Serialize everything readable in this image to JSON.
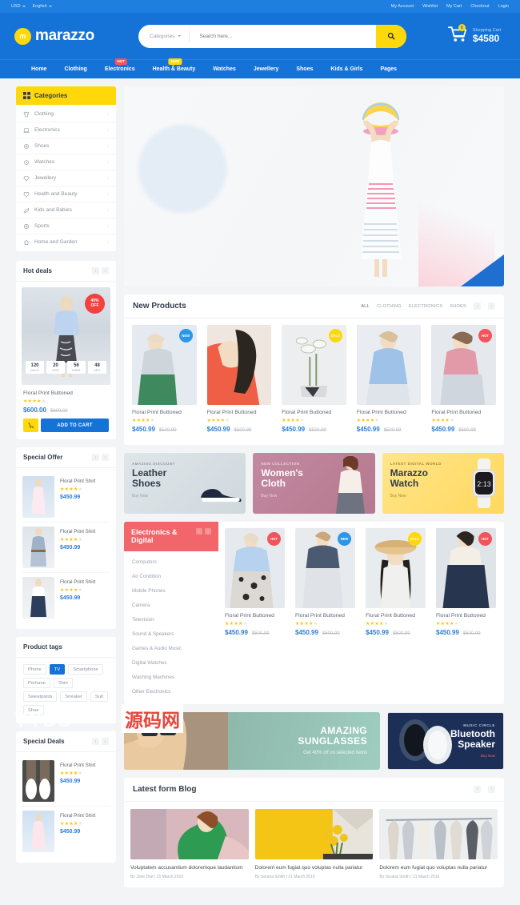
{
  "topbar": {
    "currency": "USD",
    "language": "English",
    "links": [
      "My Account",
      "Wishlist",
      "My Cart",
      "Checkout",
      "Login"
    ]
  },
  "header": {
    "logo_mark": "m",
    "logo_text": "marazzo",
    "search": {
      "category_label": "Categories",
      "placeholder": "Search here...",
      "value": "",
      "button_icon": "search-icon"
    },
    "cart": {
      "label": "Shopping Cart",
      "total": "$4580",
      "count": "0"
    }
  },
  "nav": {
    "items": [
      {
        "label": "Home",
        "badge": null
      },
      {
        "label": "Clothing",
        "badge": null
      },
      {
        "label": "Electronics",
        "badge": "HOT",
        "badge_type": "hot"
      },
      {
        "label": "Health & Beauty",
        "badge": "NEW",
        "badge_type": "new"
      },
      {
        "label": "Watches",
        "badge": null
      },
      {
        "label": "Jewellery",
        "badge": null
      },
      {
        "label": "Shoes",
        "badge": null
      },
      {
        "label": "Kids & Girls",
        "badge": null
      },
      {
        "label": "Pages",
        "badge": null
      }
    ]
  },
  "sidebar": {
    "categories": {
      "title": "Categories",
      "icon": "grid-icon",
      "items": [
        {
          "label": "Clothing",
          "icon": "shirt-icon"
        },
        {
          "label": "Electronics",
          "icon": "laptop-icon"
        },
        {
          "label": "Shoes",
          "icon": "shoe-icon"
        },
        {
          "label": "Watches",
          "icon": "watch-icon"
        },
        {
          "label": "Jewellery",
          "icon": "gem-icon"
        },
        {
          "label": "Health and Beauty",
          "icon": "heart-icon"
        },
        {
          "label": "Kids and Babies",
          "icon": "baby-icon"
        },
        {
          "label": "Sports",
          "icon": "ball-icon"
        },
        {
          "label": "Home and Garden",
          "icon": "home-icon"
        }
      ]
    },
    "hot_deals": {
      "title": "Hot deals",
      "discount_badge_line1": "40%",
      "discount_badge_line2": "OFF",
      "countdown": [
        {
          "num": "120",
          "unit": "DAYS"
        },
        {
          "num": "20",
          "unit": "HRS"
        },
        {
          "num": "56",
          "unit": "MINS"
        },
        {
          "num": "48",
          "unit": "SEC"
        }
      ],
      "product_name": "Floral Print Buttoned",
      "rating": 4,
      "price": "$600.00",
      "price_old": "$800.00",
      "add_to_cart": "ADD TO CART"
    },
    "special_offer": {
      "title": "Special Offer",
      "items": [
        {
          "name": "Floral Print Shirt",
          "rating": 4,
          "price": "$450.99"
        },
        {
          "name": "Floral Print Shirt",
          "rating": 4,
          "price": "$450.99"
        },
        {
          "name": "Floral Print Shirt",
          "rating": 4,
          "price": "$450.99"
        }
      ]
    },
    "product_tags": {
      "title": "Product tags",
      "tags": [
        {
          "label": "Phone",
          "active": false
        },
        {
          "label": "TV",
          "active": true
        },
        {
          "label": "Smartphone",
          "active": false
        },
        {
          "label": "Perfume",
          "active": false
        },
        {
          "label": "Shirt",
          "active": false
        },
        {
          "label": "Sweatpants",
          "active": false
        },
        {
          "label": "Sneaker",
          "active": false
        },
        {
          "label": "Suit",
          "active": false
        },
        {
          "label": "Shoe",
          "active": false
        }
      ]
    },
    "special_deals": {
      "title": "Special Deals",
      "items": [
        {
          "name": "Floral Print Shirt",
          "rating": 4,
          "price": "$450.99"
        },
        {
          "name": "Floral Print Shirt",
          "rating": 4,
          "price": "$450.99"
        }
      ]
    }
  },
  "main": {
    "new_products": {
      "title": "New Products",
      "tabs": [
        "ALL",
        "CLOTHING",
        "ELECTRONICS",
        "SHOES"
      ],
      "active_tab": "ALL",
      "items": [
        {
          "name": "Floral Print Buttoned",
          "rating": 4,
          "price": "$450.99",
          "price_old": "$500.99",
          "badge": "NEW",
          "badge_type": "new"
        },
        {
          "name": "Floral Print Buttoned",
          "rating": 4,
          "price": "$450.99",
          "price_old": "$500.99",
          "badge": null,
          "badge_type": null
        },
        {
          "name": "Floral Print Buttoned",
          "rating": 4,
          "price": "$450.99",
          "price_old": "$500.99",
          "badge": "SALE",
          "badge_type": "sale"
        },
        {
          "name": "Floral Print Buttoned",
          "rating": 4,
          "price": "$450.99",
          "price_old": "$500.99",
          "badge": null,
          "badge_type": null
        },
        {
          "name": "Floral Print Buttoned",
          "rating": 4,
          "price": "$450.99",
          "price_old": "$500.99",
          "badge": "HOT",
          "badge_type": "hot"
        }
      ]
    },
    "promo_banners": [
      {
        "kicker": "AMAZING DISCOUNT",
        "title_line1": "Leather",
        "title_line2": "Shoes",
        "link": "Buy Now"
      },
      {
        "kicker": "NEW COLLECTION",
        "title_line1": "Women's",
        "title_line2": "Cloth",
        "link": "Buy Now"
      },
      {
        "kicker": "LATEST DIGITAL WORLD",
        "title_line1": "Marazzo",
        "title_line2": "Watch",
        "link": "Buy Now"
      }
    ],
    "electronics": {
      "title_line1": "Electronics &",
      "title_line2": "Digital",
      "menu": [
        "Computers",
        "Air Condition",
        "Mobile Phones",
        "Camera",
        "Television",
        "Sound & Speakers",
        "Games & Audio Music",
        "Digital Watches",
        "Washing Machines",
        "Other Electronics"
      ],
      "items": [
        {
          "name": "Floral Print Buttoned",
          "rating": 4,
          "price": "$450.99",
          "price_old": "$500.99",
          "badge": "HOT",
          "badge_type": "hot"
        },
        {
          "name": "Floral Print Buttoned",
          "rating": 4,
          "price": "$450.99",
          "price_old": "$500.99",
          "badge": "NEW",
          "badge_type": "new"
        },
        {
          "name": "Floral Print Buttoned",
          "rating": 4,
          "price": "$450.99",
          "price_old": "$500.99",
          "badge": "SALE",
          "badge_type": "sale"
        },
        {
          "name": "Floral Print Buttoned",
          "rating": 4,
          "price": "$450.99",
          "price_old": "$500.99",
          "badge": "HOT",
          "badge_type": "hot"
        }
      ]
    },
    "sunglasses_banner": {
      "title_line1": "AMAZING",
      "title_line2": "SUNGLASSES",
      "subtitle": "Get 40% off on selected items"
    },
    "speaker_banner": {
      "kicker": "MUSIC CIRCLE",
      "title_line1": "Bluetooth",
      "title_line2": "Speaker",
      "link": "Buy Now"
    },
    "blog": {
      "title": "Latest form Blog",
      "posts": [
        {
          "title": "Voluptatem accusantium doloremque laudantium",
          "meta": "By Jone Doe | 21 March 2019"
        },
        {
          "title": "Dolorem eum fugiat quo voluptas nulla pariatur",
          "meta": "By Serana Smith | 21 March 2019"
        },
        {
          "title": "Dolorem eum fugiat quo voluptas nulla pariatur",
          "meta": "By Serana Smith | 21 March 2019"
        }
      ]
    }
  },
  "watermark": {
    "text": "YYDS",
    "text2": "源码网"
  }
}
